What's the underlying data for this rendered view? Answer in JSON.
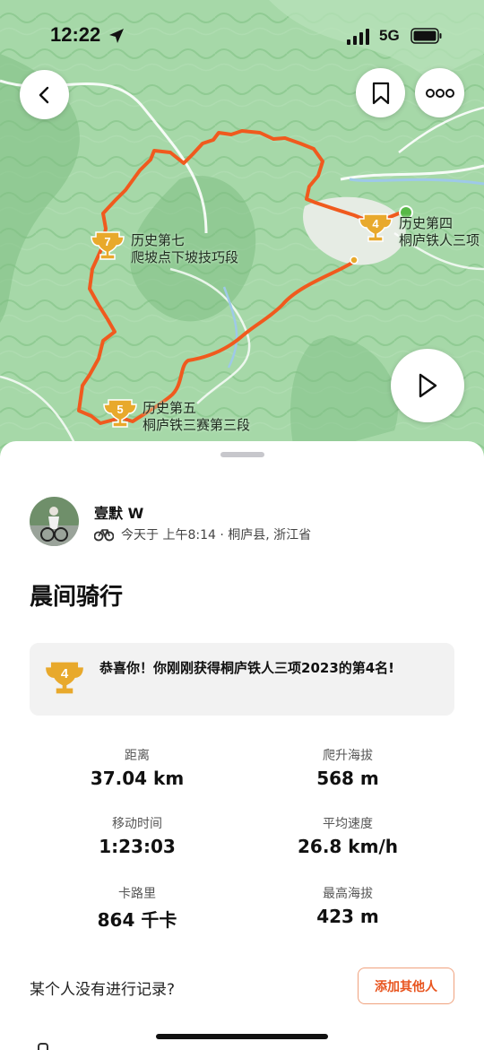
{
  "status_bar": {
    "time": "12:22",
    "network": "5G"
  },
  "map": {
    "segments": [
      {
        "rank": "7",
        "line1": "历史第七",
        "line2": "爬坡点下坡技巧段"
      },
      {
        "rank": "4",
        "line1": "历史第四",
        "line2": "桐庐铁人三项"
      },
      {
        "rank": "5",
        "line1": "历史第五",
        "line2": "桐庐铁三赛第三段"
      }
    ],
    "colors": {
      "route": "#f05a1e",
      "trophy": "#e8a92c",
      "terrain": "#9fd3a2"
    }
  },
  "activity": {
    "user_name": "壹默 W",
    "meta": "今天于 上午8:14 · 桐庐县, 浙江省",
    "title": "晨间骑行",
    "achievement": {
      "rank": "4",
      "text": "恭喜你！你刚刚获得桐庐铁人三项2023的第4名!"
    },
    "stats": [
      {
        "label": "距离",
        "value": "37.04 km"
      },
      {
        "label": "爬升海拔",
        "value": "568 m"
      },
      {
        "label": "移动时间",
        "value": "1:23:03"
      },
      {
        "label": "平均速度",
        "value": "26.8 km/h"
      },
      {
        "label": "卡路里",
        "value": "864 千卡"
      },
      {
        "label": "最高海拔",
        "value": "423 m"
      }
    ],
    "missing_prompt": "某个人没有进行记录?",
    "add_others_label": "添加其他人"
  }
}
